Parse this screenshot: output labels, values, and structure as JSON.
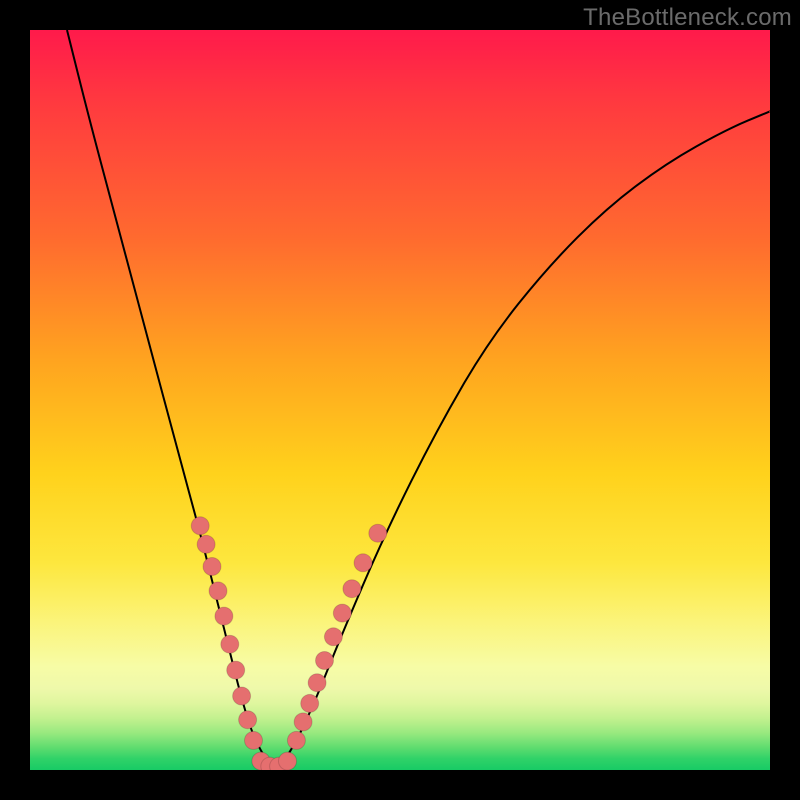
{
  "watermark": "TheBottleneck.com",
  "chart_data": {
    "type": "line",
    "title": "",
    "xlabel": "",
    "ylabel": "",
    "xlim": [
      0,
      100
    ],
    "ylim": [
      0,
      100
    ],
    "grid": false,
    "series": [
      {
        "name": "curve",
        "x": [
          5,
          8,
          12,
          16,
          20,
          23,
          25,
          27,
          28.5,
          30,
          31.5,
          33,
          35,
          38,
          42,
          48,
          55,
          62,
          70,
          78,
          86,
          94,
          100
        ],
        "y": [
          100,
          88,
          73,
          58,
          43,
          32,
          24,
          16,
          10,
          5,
          2,
          0,
          2,
          8,
          18,
          32,
          46,
          58,
          68,
          76,
          82,
          86.5,
          89
        ]
      }
    ],
    "markers": {
      "left_branch": [
        {
          "x": 23.0,
          "y": 33.0
        },
        {
          "x": 23.8,
          "y": 30.5
        },
        {
          "x": 24.6,
          "y": 27.5
        },
        {
          "x": 25.4,
          "y": 24.2
        },
        {
          "x": 26.2,
          "y": 20.8
        },
        {
          "x": 27.0,
          "y": 17.0
        },
        {
          "x": 27.8,
          "y": 13.5
        },
        {
          "x": 28.6,
          "y": 10.0
        },
        {
          "x": 29.4,
          "y": 6.8
        },
        {
          "x": 30.2,
          "y": 4.0
        }
      ],
      "right_branch": [
        {
          "x": 36.0,
          "y": 4.0
        },
        {
          "x": 36.9,
          "y": 6.5
        },
        {
          "x": 37.8,
          "y": 9.0
        },
        {
          "x": 38.8,
          "y": 11.8
        },
        {
          "x": 39.8,
          "y": 14.8
        },
        {
          "x": 41.0,
          "y": 18.0
        },
        {
          "x": 42.2,
          "y": 21.2
        },
        {
          "x": 43.5,
          "y": 24.5
        },
        {
          "x": 45.0,
          "y": 28.0
        },
        {
          "x": 47.0,
          "y": 32.0
        }
      ],
      "bottom": [
        {
          "x": 31.2,
          "y": 1.2
        },
        {
          "x": 32.4,
          "y": 0.5
        },
        {
          "x": 33.6,
          "y": 0.5
        },
        {
          "x": 34.8,
          "y": 1.2
        }
      ],
      "radius_px": 9
    }
  },
  "colors": {
    "curve": "#000000",
    "marker_fill": "#e56f6f",
    "gradient_top": "#ff1a4b",
    "gradient_bottom": "#18cb65"
  }
}
